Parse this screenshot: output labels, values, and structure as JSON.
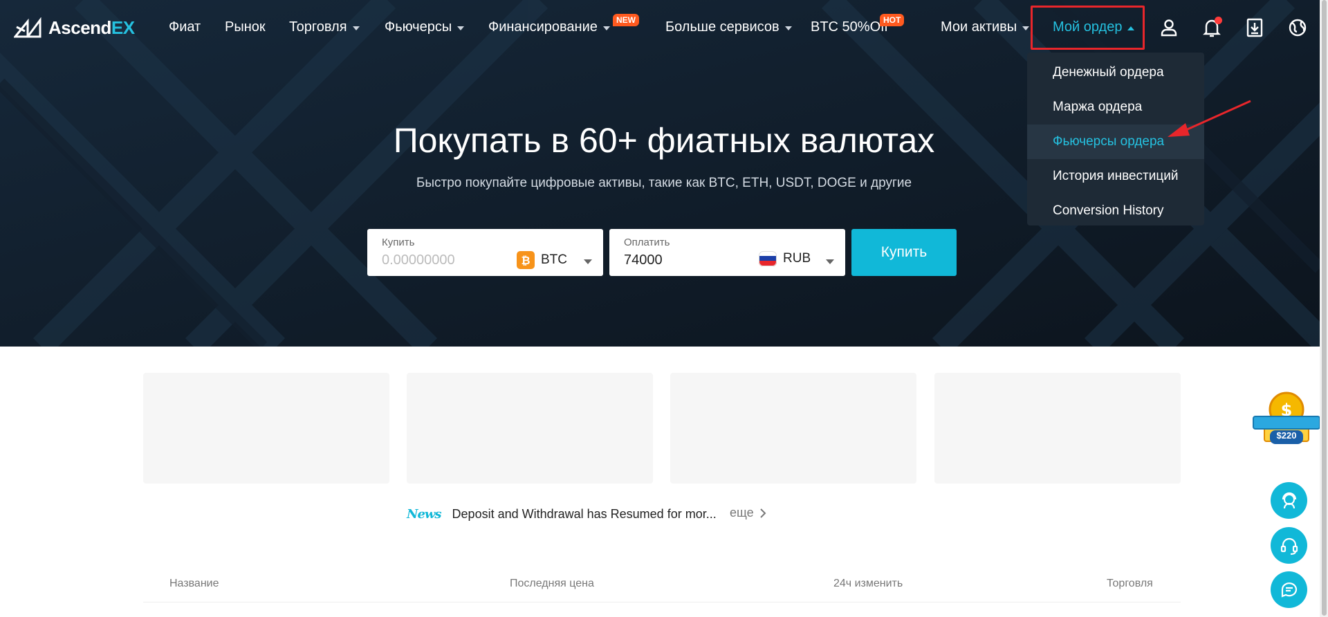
{
  "brand": {
    "logo_main": "Ascend",
    "logo_suffix": "EX"
  },
  "nav": {
    "items": [
      {
        "label": "Фиат"
      },
      {
        "label": "Рынок"
      },
      {
        "label": "Торговля"
      },
      {
        "label": "Фьючерсы"
      },
      {
        "label": "Финансирование",
        "badge": "NEW"
      },
      {
        "label": "Больше сервисов"
      },
      {
        "label": "BTC 50%Off",
        "badge": "HOT"
      },
      {
        "label": "Мои активы"
      }
    ],
    "order_label": "Мой ордер",
    "icons": [
      "user-icon",
      "bell-icon",
      "download-icon",
      "globe-icon"
    ]
  },
  "order_menu": {
    "items": [
      {
        "label": "Денежный ордера"
      },
      {
        "label": "Маржа ордера"
      },
      {
        "label": "Фьючерсы ордера"
      },
      {
        "label": "История инвестиций"
      },
      {
        "label": "Conversion History"
      }
    ],
    "active_index": 2
  },
  "hero": {
    "title": "Покупать в 60+ фиатных валютах",
    "subtitle": "Быстро покупайте цифровые активы, такие как BTC, ETH, USDT, DOGE и другие"
  },
  "buy_form": {
    "buy_label": "Купить",
    "buy_placeholder": "0.00000000",
    "buy_currency": "BTC",
    "pay_label": "Оплатить",
    "pay_value": "74000",
    "pay_currency": "RUB",
    "submit_label": "Купить"
  },
  "news": {
    "tag": "News",
    "text": "Deposit and Withdrawal has Resumed for mor...",
    "more": "еще"
  },
  "table_head": {
    "name": "Название",
    "last_price": "Последняя цена",
    "change": "24ч изменить",
    "trade": "Торговля"
  },
  "promo": {
    "amount": "$220"
  },
  "colors": {
    "accent": "#11b8d8",
    "hero_bg": "#0f1a26",
    "highlight_border": "#e8262b",
    "badge": "#ff5a1f"
  }
}
